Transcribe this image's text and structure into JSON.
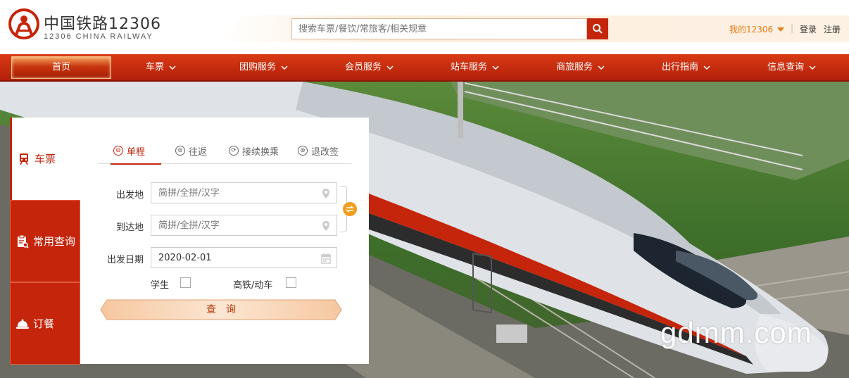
{
  "header": {
    "brand_cn": "中国铁路12306",
    "brand_en": "12306 CHINA RAILWAY",
    "search_placeholder": "搜索车票/餐饮/常旅客/相关规章",
    "my_account": "我的12306",
    "separator": "|",
    "login": "登录",
    "register": "注册"
  },
  "nav": {
    "items": [
      {
        "label": "首页"
      },
      {
        "label": "车票"
      },
      {
        "label": "团购服务"
      },
      {
        "label": "会员服务"
      },
      {
        "label": "站车服务"
      },
      {
        "label": "商旅服务"
      },
      {
        "label": "出行指南"
      },
      {
        "label": "信息查询"
      }
    ]
  },
  "sidebar": {
    "tabs": [
      {
        "label": "车票",
        "icon": "train-icon"
      },
      {
        "label": "常用查询",
        "icon": "clipboard-search-icon"
      },
      {
        "label": "订餐",
        "icon": "food-cover-icon"
      }
    ]
  },
  "trip_tabs": [
    {
      "label": "单程",
      "symbol": "⊖"
    },
    {
      "label": "往返",
      "symbol": "⊜"
    },
    {
      "label": "接续换乘",
      "symbol": "⟳"
    },
    {
      "label": "退改签",
      "symbol": "⊗"
    }
  ],
  "form": {
    "from_label": "出发地",
    "from_placeholder": "简拼/全拼/汉字",
    "to_label": "到达地",
    "to_placeholder": "简拼/全拼/汉字",
    "date_label": "出发日期",
    "date_value": "2020-02-01",
    "student_label": "学生",
    "highspeed_label": "高铁/动车",
    "query_label": "查询"
  },
  "watermark": "gdmm.com",
  "colors": {
    "brand_red": "#c5250b",
    "accent_orange": "#e97b13",
    "swap_orange": "#f39d1f"
  }
}
